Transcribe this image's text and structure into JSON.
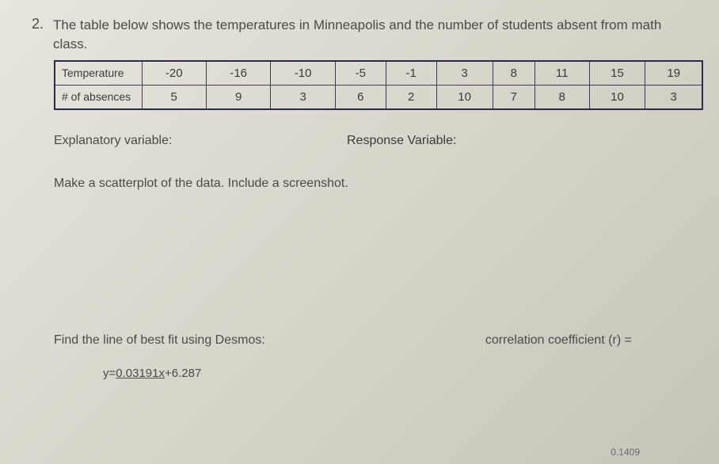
{
  "question": {
    "number": "2.",
    "text": "The table below shows the temperatures in Minneapolis and the number of students absent from math class."
  },
  "table": {
    "rows": [
      {
        "header": "Temperature",
        "cells": [
          "-20",
          "-16",
          "-10",
          "-5",
          "-1",
          "3",
          "8",
          "11",
          "15",
          "19"
        ]
      },
      {
        "header": "# of absences",
        "cells": [
          "5",
          "9",
          "3",
          "6",
          "2",
          "10",
          "7",
          "8",
          "10",
          "3"
        ]
      }
    ]
  },
  "labels": {
    "explanatory": "Explanatory variable:",
    "response": "Response Variable:",
    "scatter": "Make a scatterplot of the data. Include a screenshot.",
    "findLine": "Find the line of best fit using Desmos:",
    "correlation": "correlation coefficient (r) =",
    "equation_prefix": "y=",
    "equation_mid": "0.03191x",
    "equation_suffix": "+6.287",
    "footer": "0.1409"
  },
  "chart_data": {
    "type": "table",
    "title": "Temperatures in Minneapolis vs number of students absent from math class",
    "columns": [
      "Temperature",
      "# of absences"
    ],
    "x": [
      -20,
      -16,
      -10,
      -5,
      -1,
      3,
      8,
      11,
      15,
      19
    ],
    "y": [
      5,
      9,
      3,
      6,
      2,
      10,
      7,
      8,
      10,
      3
    ],
    "regression": {
      "slope": 0.03191,
      "intercept": 6.287,
      "equation": "y = 0.03191x + 6.287",
      "r": 0.1409
    }
  }
}
